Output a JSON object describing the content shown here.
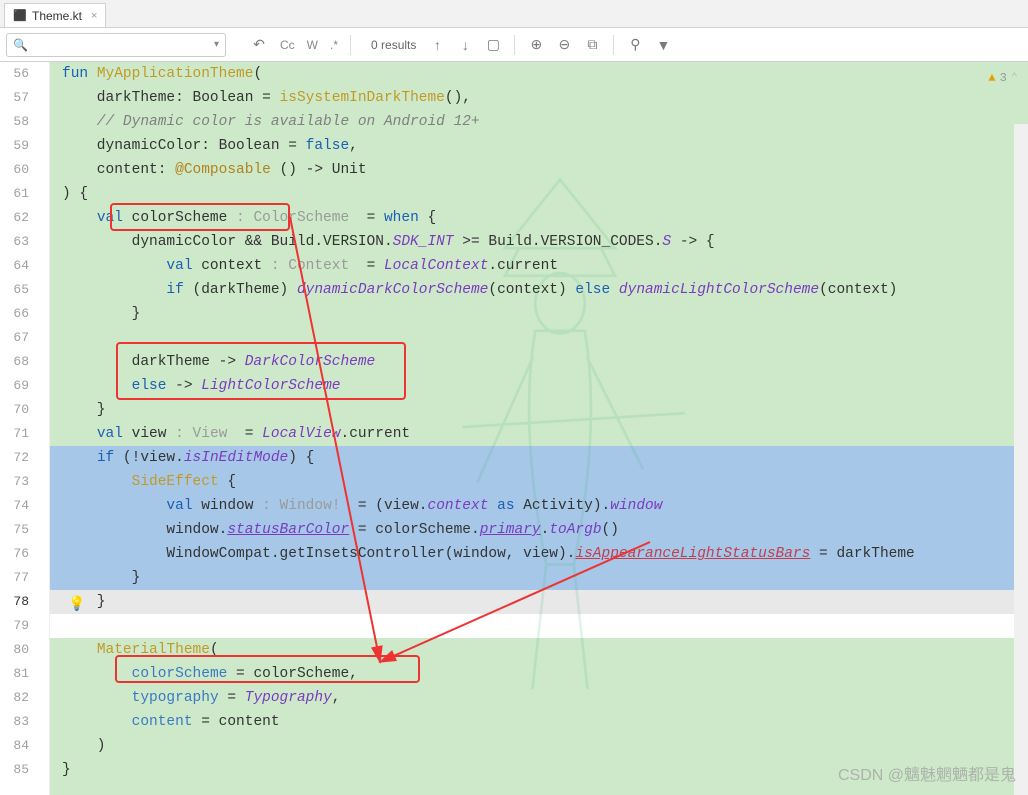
{
  "tab": {
    "icon": "kt",
    "label": "Theme.kt",
    "close": "×"
  },
  "find": {
    "placeholder": "",
    "results": "0 results",
    "cc": "Cc",
    "w": "W"
  },
  "warn": {
    "count": "3"
  },
  "watermark": "CSDN @魑魅魍魉都是鬼",
  "gutter": [
    "56",
    "57",
    "58",
    "59",
    "60",
    "61",
    "62",
    "63",
    "64",
    "65",
    "66",
    "67",
    "68",
    "69",
    "70",
    "71",
    "72",
    "73",
    "74",
    "75",
    "76",
    "77",
    "78",
    "79",
    "80",
    "81",
    "82",
    "83",
    "84",
    "85"
  ],
  "code": {
    "l56_kw": "fun ",
    "l56_fn": "MyApplicationTheme",
    "l56_t": "(",
    "l57": "    darkTheme: Boolean = ",
    "l57_fn": "isSystemInDarkTheme",
    "l57_t": "(),",
    "l58": "    // Dynamic color is available on Android 12+",
    "l59": "    dynamicColor: Boolean = ",
    "l59_kw": "false",
    "l59_t": ",",
    "l60": "    content: ",
    "l60_ann": "@Composable",
    "l60_t": " () -> Unit",
    "l61": ") {",
    "l62a": "    ",
    "l62_kw": "val",
    "l62b": " colorScheme ",
    "l62_hint": ": ColorScheme ",
    "l62c": " = ",
    "l62_kw2": "when",
    "l62d": " {",
    "l63": "        dynamicColor && Build.VERSION.",
    "l63_p": "SDK_INT",
    "l63b": " >= Build.VERSION_CODES.",
    "l63_p2": "S",
    "l63c": " -> {",
    "l64a": "            ",
    "l64_kw": "val",
    "l64b": " context ",
    "l64_hint": ": Context ",
    "l64c": " = ",
    "l64_p": "LocalContext",
    "l64d": ".current",
    "l65a": "            ",
    "l65_kw": "if",
    "l65b": " (darkTheme) ",
    "l65_f1": "dynamicDarkColorScheme",
    "l65c": "(context) ",
    "l65_kw2": "else",
    "l65d": " ",
    "l65_f2": "dynamicLightColorScheme",
    "l65e": "(context)",
    "l66": "        }",
    "l67": "",
    "l68a": "        darkTheme -> ",
    "l68_p": "DarkColorScheme",
    "l69a": "        ",
    "l69_kw": "else",
    "l69b": " -> ",
    "l69_p": "LightColorScheme",
    "l70": "    }",
    "l71a": "    ",
    "l71_kw": "val",
    "l71b": " view ",
    "l71_hint": ": View ",
    "l71c": " = ",
    "l71_p": "LocalView",
    "l71d": ".current",
    "l72a": "    ",
    "l72_kw": "if",
    "l72b": " (!view.",
    "l72_p": "isInEditMode",
    "l72c": ") {",
    "l73a": "        ",
    "l73_fn": "SideEffect",
    "l73b": " {",
    "l74a": "            ",
    "l74_kw": "val",
    "l74b": " window ",
    "l74_hint": ": Window! ",
    "l74c": " = (view.",
    "l74_p": "context",
    "l74d": " ",
    "l74_kw2": "as",
    "l74e": " Activity).",
    "l74_p2": "window",
    "l75a": "            window.",
    "l75_p": "statusBarColor",
    "l75b": " = colorScheme.",
    "l75_p2": "primary",
    "l75c": ".",
    "l75_f": "toArgb",
    "l75d": "()",
    "l76a": "            WindowCompat.getInsetsController(window, view).",
    "l76_p": "isAppearanceLightStatusBars",
    "l76b": " = darkTheme",
    "l77": "        }",
    "l78": "    }",
    "l79": "",
    "l80a": "    ",
    "l80_fn": "MaterialTheme",
    "l80b": "(",
    "l81a": "        ",
    "l81_n": "colorScheme",
    "l81b": " = colorScheme,",
    "l82a": "        ",
    "l82_n": "typography",
    "l82b": " = ",
    "l82_p": "Typography",
    "l82c": ",",
    "l83a": "        ",
    "l83_n": "content",
    "l83b": " = content",
    "l84": "    )",
    "l85": "}"
  }
}
